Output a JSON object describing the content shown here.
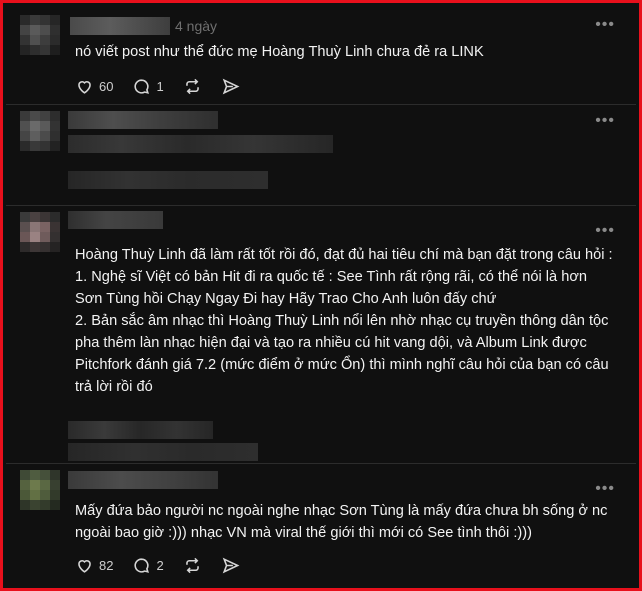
{
  "comments": [
    {
      "time": "4 ngày",
      "text": "nó viết post như thể đức mẹ Hoàng Thuỳ Linh chưa đẻ ra LINK",
      "likes": "60",
      "replies": "1"
    },
    {
      "text_lines": [
        "Hoàng Thuỳ Linh đã làm rất tốt rồi đó, đạt đủ hai tiêu chí mà bạn đặt trong câu hỏi :",
        "1. Nghệ sĩ Việt có bản Hit đi ra quốc tế : See Tình rất rộng rãi, có thể nói là hơn Sơn Tùng hồi Chạy Ngay Đi hay Hãy Trao Cho Anh luôn đấy chứ",
        "2. Bản sắc âm nhạc thì Hoàng Thuỳ Linh nổi lên nhờ nhạc cụ truyền thông dân tộc pha thêm làn nhạc hiện đại và tạo ra nhiều cú hit vang dội, và Album Link được Pitchfork đánh giá 7.2 (mức điểm ở mức Ổn) thì mình nghĩ câu hỏi của bạn có câu trả lời rồi đó"
      ]
    },
    {
      "text": "Mấy đứa bảo người nc ngoài nghe nhạc Sơn Tùng là mấy đứa chưa bh sống ở nc ngoài bao giờ :))) nhạc VN mà viral thế giới thì mới có See tình thôi :)))",
      "likes": "82",
      "replies": "2"
    }
  ],
  "icons": [
    "more-icon",
    "heart-icon",
    "reply-icon",
    "repost-icon",
    "share-icon"
  ],
  "colors": {
    "frame": "#e8101c",
    "background": "#101010",
    "text": "#f3f3f3",
    "muted": "#6f6f6f"
  }
}
